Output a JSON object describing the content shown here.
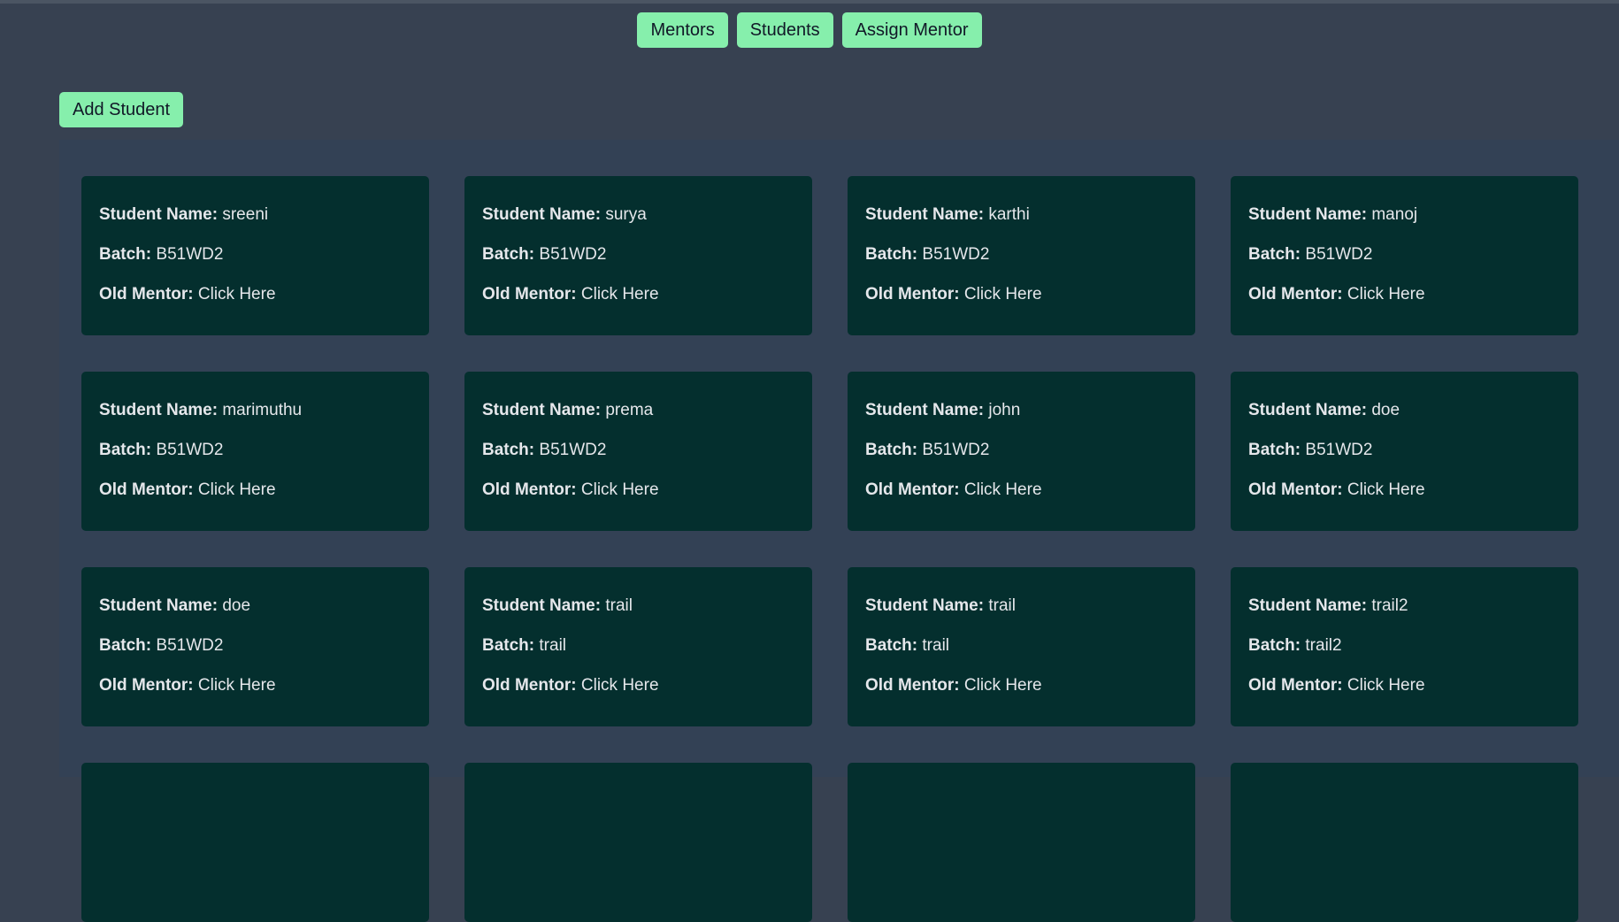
{
  "nav": {
    "items": [
      {
        "label": "Mentors",
        "name": "mentors-nav-button"
      },
      {
        "label": "Students",
        "name": "students-nav-button"
      },
      {
        "label": "Assign Mentor",
        "name": "assign-mentor-nav-button"
      }
    ]
  },
  "actions": {
    "add_student_label": "Add Student"
  },
  "labels": {
    "name": "Student Name:",
    "batch": "Batch:",
    "old_mentor": "Old Mentor:"
  },
  "students": [
    {
      "name": "sreeni",
      "batch": "B51WD2",
      "old_mentor": "Click Here"
    },
    {
      "name": "surya",
      "batch": "B51WD2",
      "old_mentor": "Click Here"
    },
    {
      "name": "karthi",
      "batch": "B51WD2",
      "old_mentor": "Click Here"
    },
    {
      "name": "manoj",
      "batch": "B51WD2",
      "old_mentor": "Click Here"
    },
    {
      "name": "marimuthu",
      "batch": "B51WD2",
      "old_mentor": "Click Here"
    },
    {
      "name": "prema",
      "batch": "B51WD2",
      "old_mentor": "Click Here"
    },
    {
      "name": "john",
      "batch": "B51WD2",
      "old_mentor": "Click Here"
    },
    {
      "name": "doe",
      "batch": "B51WD2",
      "old_mentor": "Click Here"
    },
    {
      "name": "doe",
      "batch": "B51WD2",
      "old_mentor": "Click Here"
    },
    {
      "name": "trail",
      "batch": "trail",
      "old_mentor": "Click Here"
    },
    {
      "name": "trail",
      "batch": "trail",
      "old_mentor": "Click Here"
    },
    {
      "name": "trail2",
      "batch": "trail2",
      "old_mentor": "Click Here"
    },
    {
      "name": "",
      "batch": "",
      "old_mentor": ""
    },
    {
      "name": "",
      "batch": "",
      "old_mentor": ""
    },
    {
      "name": "",
      "batch": "",
      "old_mentor": ""
    },
    {
      "name": "",
      "batch": "",
      "old_mentor": ""
    }
  ],
  "colors": {
    "background": "#374151",
    "panel": "#334155",
    "card": "#042f2e",
    "button": "#86efac",
    "text": "#e5e7eb"
  }
}
